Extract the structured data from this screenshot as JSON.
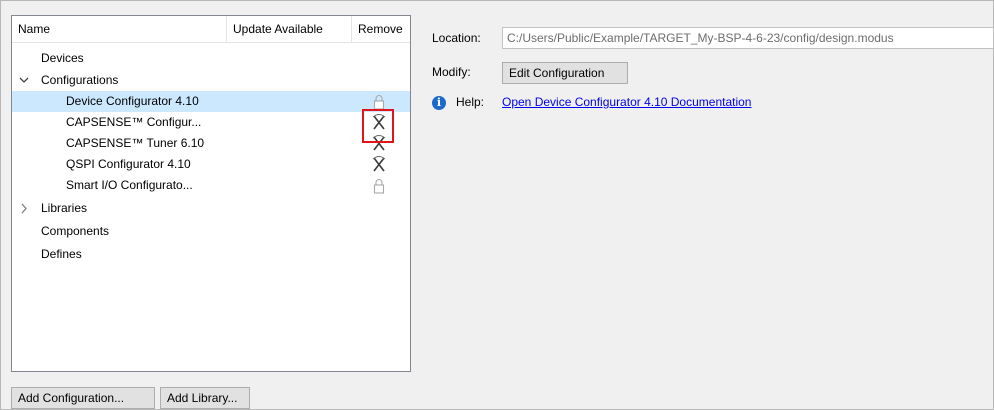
{
  "tree": {
    "columns": {
      "name": "Name",
      "update_available": "Update Available",
      "remove": "Remove"
    },
    "rows": [
      {
        "label": "Devices",
        "level": 0,
        "expander": "",
        "remove_icon": "none"
      },
      {
        "label": "Configurations",
        "level": 0,
        "expander": "expanded",
        "remove_icon": "none"
      },
      {
        "label": "Device Configurator 4.10",
        "level": 1,
        "expander": "",
        "remove_icon": "lock-icon",
        "selected": true
      },
      {
        "label": "CAPSENSE™ Configur...",
        "level": 1,
        "expander": "",
        "remove_icon": "remove-icon"
      },
      {
        "label": "CAPSENSE™ Tuner 6.10",
        "level": 1,
        "expander": "",
        "remove_icon": "remove-icon"
      },
      {
        "label": "QSPI Configurator 4.10",
        "level": 1,
        "expander": "",
        "remove_icon": "remove-icon"
      },
      {
        "label": "Smart I/O Configurato...",
        "level": 1,
        "expander": "",
        "remove_icon": "lock-icon"
      },
      {
        "label": "Libraries",
        "level": 0,
        "expander": "collapsed",
        "remove_icon": "none"
      },
      {
        "label": "Components",
        "level": 0,
        "expander": "",
        "remove_icon": "none"
      },
      {
        "label": "Defines",
        "level": 0,
        "expander": "",
        "remove_icon": "none"
      }
    ]
  },
  "buttons": {
    "add_configuration": "Add Configuration...",
    "add_library": "Add Library..."
  },
  "details": {
    "location_label": "Location:",
    "location_value": "C:/Users/Public/Example/TARGET_My-BSP-4-6-23/config/design.modus",
    "modify_label": "Modify:",
    "edit_button": "Edit Configuration",
    "help_label": "Help:",
    "help_link": "Open Device Configurator 4.10 Documentation"
  },
  "colors": {
    "selection": "#cce8ff",
    "highlight_box": "#e0141a",
    "link": "#0000ee",
    "info_icon": "#1b6ac9"
  },
  "icons": {
    "expanded": "chevron-down-icon",
    "collapsed": "chevron-right-icon",
    "info": "info-icon",
    "remove": "remove-icon",
    "lock": "lock-icon"
  }
}
